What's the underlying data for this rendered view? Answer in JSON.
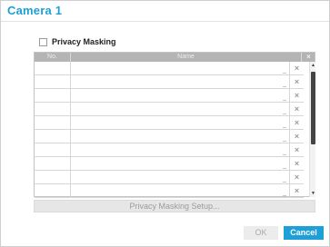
{
  "dialog": {
    "title": "Camera 1"
  },
  "privacy_masking": {
    "label": "Privacy Masking",
    "checked": false
  },
  "table": {
    "columns": {
      "no": "No.",
      "name": "Name",
      "delete_icon": "×"
    },
    "row_count": 10,
    "delete_glyph": "×",
    "dropdown_glyph": "_"
  },
  "setup_button": {
    "label": "Privacy Masking Setup..."
  },
  "footer": {
    "ok_label": "OK",
    "cancel_label": "Cancel"
  },
  "colors": {
    "accent": "#1e9fd8",
    "header": "#b4b4b4",
    "disabled_text": "#a9a9a9"
  }
}
